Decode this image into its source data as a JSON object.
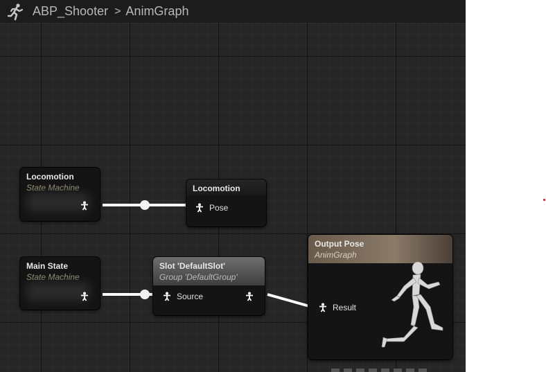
{
  "breadcrumb": {
    "icon": "running-figure-icon",
    "root": "ABP_Shooter",
    "separator": ">",
    "current": "AnimGraph"
  },
  "nodes": {
    "locomotion_sm": {
      "title": "Locomotion",
      "subtitle": "State Machine"
    },
    "locomotion_ref": {
      "title": "Locomotion",
      "pin": "Pose"
    },
    "main_state_sm": {
      "title": "Main State",
      "subtitle": "State Machine"
    },
    "slot": {
      "title": "Slot 'DefaultSlot'",
      "subtitle": "Group 'DefaultGroup'",
      "pin": "Source"
    },
    "output_pose": {
      "title": "Output Pose",
      "subtitle": "AnimGraph",
      "pin": "Result"
    }
  },
  "colors": {
    "graph_bg": "#262626",
    "wire": "#ffffff",
    "subtitle": "#9a9a7e",
    "slot_header": "#6e6e6e",
    "output_header": "#8a7a68"
  }
}
